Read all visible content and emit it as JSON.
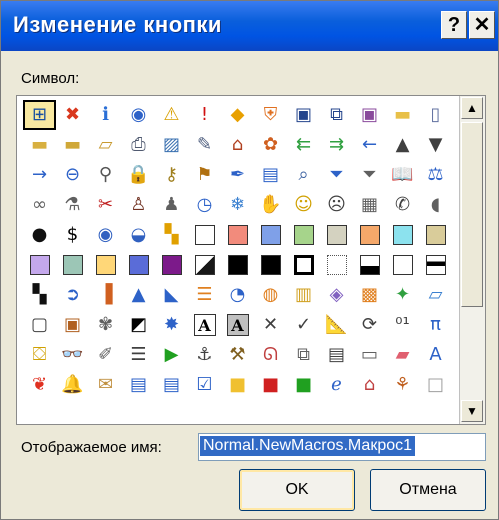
{
  "window": {
    "title": "Изменение кнопки",
    "help_label": "?",
    "close_label": "✕"
  },
  "symbol_label": "Символ:",
  "display_name": {
    "label": "Отображаемое имя:",
    "value": "Normal.NewMacros.Макрос1"
  },
  "buttons": {
    "ok": "OK",
    "cancel": "Отмена"
  },
  "scroll": {
    "up": "▲",
    "down": "▼"
  },
  "icons": [
    {
      "name": "org-chart-icon",
      "g": "⊞",
      "c": "#1a4fa0",
      "sel": true
    },
    {
      "name": "error-icon",
      "g": "✖",
      "c": "#d9381e"
    },
    {
      "name": "info-icon",
      "g": "ℹ",
      "c": "#2b6fd6"
    },
    {
      "name": "target-icon",
      "g": "◉",
      "c": "#2d62c8"
    },
    {
      "name": "warning-icon",
      "g": "⚠",
      "c": "#d8a000"
    },
    {
      "name": "exclamation-icon",
      "g": "!",
      "c": "#d01010"
    },
    {
      "name": "diamond-warning-icon",
      "g": "◆",
      "c": "#e8a000"
    },
    {
      "name": "shield-icon",
      "g": "⛨",
      "c": "#e07020"
    },
    {
      "name": "save-icon",
      "g": "▣",
      "c": "#24458c"
    },
    {
      "name": "copy-docs-icon",
      "g": "⧉",
      "c": "#24458c"
    },
    {
      "name": "save-all-icon",
      "g": "▣",
      "c": "#8a4a9c"
    },
    {
      "name": "folder-icon",
      "g": "▬",
      "c": "#e8c048"
    },
    {
      "name": "new-document-icon",
      "g": "▯",
      "c": "#6070a0"
    },
    {
      "name": "new-folder-icon",
      "g": "▬",
      "c": "#d8b040"
    },
    {
      "name": "folders-icon",
      "g": "▬",
      "c": "#d0a838"
    },
    {
      "name": "open-folder-icon",
      "g": "▱",
      "c": "#c89a30"
    },
    {
      "name": "printer-icon",
      "g": "⎙",
      "c": "#505a70"
    },
    {
      "name": "picture-icon",
      "g": "▨",
      "c": "#3a70b0"
    },
    {
      "name": "edit-document-icon",
      "g": "✎",
      "c": "#506080"
    },
    {
      "name": "home-icon",
      "g": "⌂",
      "c": "#b04020"
    },
    {
      "name": "palette-icon",
      "g": "✿",
      "c": "#d06020"
    },
    {
      "name": "back-back-icon",
      "g": "⇇",
      "c": "#30a040"
    },
    {
      "name": "forward-forward-icon",
      "g": "⇉",
      "c": "#30a040"
    },
    {
      "name": "arrow-left-icon",
      "g": "←",
      "c": "#2d62c8"
    },
    {
      "name": "triangle-up-icon",
      "g": "▲",
      "c": "#404040"
    },
    {
      "name": "triangle-down-icon",
      "g": "▼",
      "c": "#404040"
    },
    {
      "name": "arrow-right-icon",
      "g": "→",
      "c": "#2d62c8"
    },
    {
      "name": "circle-back-icon",
      "g": "⊖",
      "c": "#2d62c8"
    },
    {
      "name": "pin-icon",
      "g": "⚲",
      "c": "#555"
    },
    {
      "name": "lock-icon",
      "g": "🔒",
      "c": "#c09020"
    },
    {
      "name": "key-icon",
      "g": "⚷",
      "c": "#a08020"
    },
    {
      "name": "flag-icon",
      "g": "⚑",
      "c": "#b07010"
    },
    {
      "name": "pen-icon",
      "g": "✒",
      "c": "#2d62c8"
    },
    {
      "name": "window-icon",
      "g": "▤",
      "c": "#2d62c8"
    },
    {
      "name": "magnifier-icon",
      "g": "⌕",
      "c": "#3a60a0"
    },
    {
      "name": "filter-icon",
      "g": "⏷",
      "c": "#2d62c8"
    },
    {
      "name": "funnel-icon",
      "g": "⏷",
      "c": "#606060"
    },
    {
      "name": "book-icon",
      "g": "📖",
      "c": "#2d62c8"
    },
    {
      "name": "scales-icon",
      "g": "⚖",
      "c": "#2d62c8"
    },
    {
      "name": "link-icon",
      "g": "∞",
      "c": "#606060"
    },
    {
      "name": "microphone-icon",
      "g": "⚗",
      "c": "#606060"
    },
    {
      "name": "cut-icon",
      "g": "✂",
      "c": "#c02020"
    },
    {
      "name": "person-icon",
      "g": "♙",
      "c": "#703020"
    },
    {
      "name": "user-icon",
      "g": "♟",
      "c": "#606060"
    },
    {
      "name": "clock-icon",
      "g": "◷",
      "c": "#2d62c8"
    },
    {
      "name": "snowflake-icon",
      "g": "❄",
      "c": "#3a80d0"
    },
    {
      "name": "hand-icon",
      "g": "✋",
      "c": "#d0a020"
    },
    {
      "name": "smiley-icon",
      "g": "☺",
      "c": "#d0a000"
    },
    {
      "name": "sad-face-icon",
      "g": "☹",
      "c": "#404040"
    },
    {
      "name": "calculator-icon",
      "g": "▦",
      "c": "#606060"
    },
    {
      "name": "phone-icon",
      "g": "✆",
      "c": "#404040"
    },
    {
      "name": "piggy-bank-icon",
      "g": "◖",
      "c": "#606060"
    },
    {
      "name": "eight-ball-icon",
      "g": "●",
      "c": "#101010"
    },
    {
      "name": "dollar-field-icon",
      "g": "$",
      "c": "#000"
    },
    {
      "name": "eye-icon",
      "g": "◉",
      "c": "#3060c0"
    },
    {
      "name": "eye-closed-icon",
      "g": "◒",
      "c": "#3060c0"
    },
    {
      "name": "quad-color-icon",
      "g": "▚",
      "c": "#e0a000"
    },
    {
      "swatch": "#ffffff"
    },
    {
      "swatch": "#f28b7c"
    },
    {
      "swatch": "#7fa0e8"
    },
    {
      "swatch": "#a6d48b"
    },
    {
      "swatch": "#d4d2c0"
    },
    {
      "swatch": "#f5a86a"
    },
    {
      "swatch": "#8ce2ee"
    },
    {
      "swatch": "#d9cc9a"
    },
    {
      "swatch": "#c4a8ec"
    },
    {
      "swatch": "#9cc6b6"
    },
    {
      "swatch": "#ffd778"
    },
    {
      "swatch": "#5a6cd8"
    },
    {
      "swatch": "#7c1a8a"
    },
    {
      "swatch": "#181818",
      "split": true
    },
    {
      "swatch": "#000000"
    },
    {
      "swatch": "#000000",
      "half": true
    },
    {
      "swatch": "#ffffff",
      "thick": true
    },
    {
      "swatch": "#ffffff",
      "dotted": true
    },
    {
      "swatch": "#ffffff",
      "bottomhalf": true
    },
    {
      "swatch": "#ffffff"
    },
    {
      "swatch": "#ffffff",
      "tophalf": true
    },
    {
      "name": "checker-icon",
      "g": "▚",
      "c": "#101010"
    },
    {
      "name": "circle-arrow-icon",
      "g": "➲",
      "c": "#2d62c8"
    },
    {
      "name": "bar-chart-icon",
      "g": "▐",
      "c": "#d06020"
    },
    {
      "name": "cone-icon",
      "g": "▲",
      "c": "#2d62c8"
    },
    {
      "name": "area-chart-icon",
      "g": "◣",
      "c": "#2d62c8"
    },
    {
      "name": "bars-icon",
      "g": "☰",
      "c": "#e08020"
    },
    {
      "name": "pie-chart-icon",
      "g": "◔",
      "c": "#2d62c8"
    },
    {
      "name": "donut-icon",
      "g": "◍",
      "c": "#e08020"
    },
    {
      "name": "cylinder-icon",
      "g": "▥",
      "c": "#d0a020"
    },
    {
      "name": "cube-icon",
      "g": "◈",
      "c": "#8060c0"
    },
    {
      "name": "boxes-icon",
      "g": "▩",
      "c": "#e08020"
    },
    {
      "name": "gift-icon",
      "g": "✦",
      "c": "#30a040"
    },
    {
      "name": "landscape-icon",
      "g": "▱",
      "c": "#3a80d0"
    },
    {
      "name": "frame-icon",
      "g": "▢",
      "c": "#404040"
    },
    {
      "name": "portrait-icon",
      "g": "▣",
      "c": "#b06020"
    },
    {
      "name": "art-palette-icon",
      "g": "✾",
      "c": "#606060"
    },
    {
      "name": "diagonal-icon",
      "g": "◩",
      "c": "#000"
    },
    {
      "name": "sparkle-icon",
      "g": "✸",
      "c": "#2d62c8"
    },
    {
      "name": "letter-a-icon",
      "g": "A",
      "c": "#000",
      "boxed": true
    },
    {
      "name": "letter-a-shaded-icon",
      "g": "A",
      "c": "#000",
      "boxed": true,
      "bg": "#c0c0c0"
    },
    {
      "name": "x-mark-icon",
      "g": "✕",
      "c": "#404040"
    },
    {
      "name": "check-mark-icon",
      "g": "✓",
      "c": "#404040"
    },
    {
      "name": "ruler-pencil-icon",
      "g": "📐",
      "c": "#d0a020"
    },
    {
      "name": "refresh-icon",
      "g": "⟳",
      "c": "#404040"
    },
    {
      "name": "binary-icon",
      "g": "⁰¹",
      "c": "#404040"
    },
    {
      "name": "pi-icon",
      "g": "π",
      "c": "#2d62c8"
    },
    {
      "name": "paint-bucket-icon",
      "g": "⛋",
      "c": "#d0a000"
    },
    {
      "name": "binoculars-icon",
      "g": "👓",
      "c": "#404040"
    },
    {
      "name": "brush-icon",
      "g": "✐",
      "c": "#606060"
    },
    {
      "name": "list-icon",
      "g": "☰",
      "c": "#404040"
    },
    {
      "name": "play-icon",
      "g": "▶",
      "c": "#20a020"
    },
    {
      "name": "anchor-icon",
      "g": "⚓",
      "c": "#404040"
    },
    {
      "name": "tools-icon",
      "g": "⚒",
      "c": "#806020"
    },
    {
      "name": "lasso-icon",
      "g": "ᘏ",
      "c": "#c04040"
    },
    {
      "name": "copy-icon",
      "g": "⧉",
      "c": "#606060"
    },
    {
      "name": "paste-icon",
      "g": "▤",
      "c": "#404040"
    },
    {
      "name": "document-lines-icon",
      "g": "▭",
      "c": "#606060"
    },
    {
      "name": "eraser-icon",
      "g": "▰",
      "c": "#e06070"
    },
    {
      "name": "wordart-icon",
      "g": "A",
      "c": "#2d62c8"
    },
    {
      "name": "msn-butterfly-icon",
      "g": "❦",
      "c": "#e03020"
    },
    {
      "name": "bell-icon",
      "g": "🔔",
      "c": "#d0a020"
    },
    {
      "name": "envelope-icon",
      "g": "✉",
      "c": "#c09040"
    },
    {
      "name": "form-icon",
      "g": "▤",
      "c": "#2d62c8"
    },
    {
      "name": "form-lines-icon",
      "g": "▤",
      "c": "#2d62c8"
    },
    {
      "name": "checklist-icon",
      "g": "☑",
      "c": "#2d62c8"
    },
    {
      "name": "yellow-box-icon",
      "g": "■",
      "c": "#f0c030"
    },
    {
      "name": "red-box-icon",
      "g": "■",
      "c": "#d02020"
    },
    {
      "name": "green-box-icon",
      "g": "■",
      "c": "#20a020"
    },
    {
      "name": "globe-e-icon",
      "g": "ℯ",
      "c": "#2d62c8"
    },
    {
      "name": "house-globe-icon",
      "g": "⌂",
      "c": "#c04040"
    },
    {
      "name": "signpost-icon",
      "g": "⚘",
      "c": "#c06020"
    },
    {
      "name": "blank-box-icon",
      "g": "□",
      "c": "#a0a0a0"
    }
  ]
}
